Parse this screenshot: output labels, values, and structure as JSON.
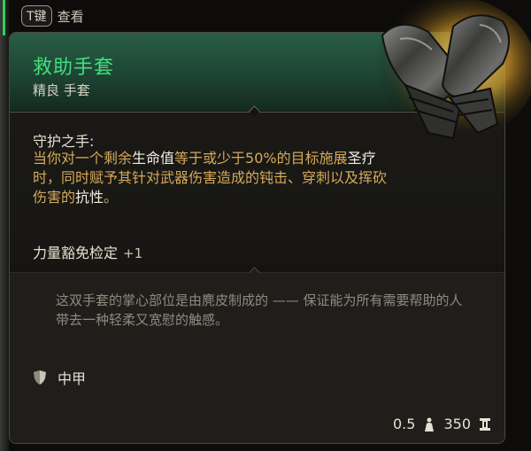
{
  "hint": {
    "key": "T键",
    "label": "查看"
  },
  "item": {
    "name": "救助手套",
    "rarity_type": "精良 手套",
    "passive_name": "守护之手:",
    "passive_desc": {
      "p1": "当你对一个剩余",
      "k1": "生命值",
      "p2": "等于或少于50%的目标施展",
      "k2": "圣疗",
      "p3": "时，同时赋予其针对武器伤害造成的钝击、穿刺以及挥砍伤害的",
      "k3": "抗性",
      "p4": "。"
    },
    "bonus_label": "力量豁免检定",
    "bonus_value": "+1",
    "flavor": "这双手套的掌心部位是由麂皮制成的 —— 保证能为所有需要帮助的人带去一种轻柔又宽慰的触感。",
    "armor_type": "中甲",
    "weight": "0.5",
    "value": "350"
  },
  "icons": {
    "armor": "shield-icon",
    "weight": "weight-icon",
    "value": "gold-coin-icon",
    "item": "gauntlet-icon"
  },
  "colors": {
    "title": "#3fe07e",
    "header_bg": "#2a5e45",
    "desc": "#d5a95b",
    "keyword": "#f2ede3",
    "flavor": "#8f8a80",
    "gold_glow": "#f2c14a"
  }
}
